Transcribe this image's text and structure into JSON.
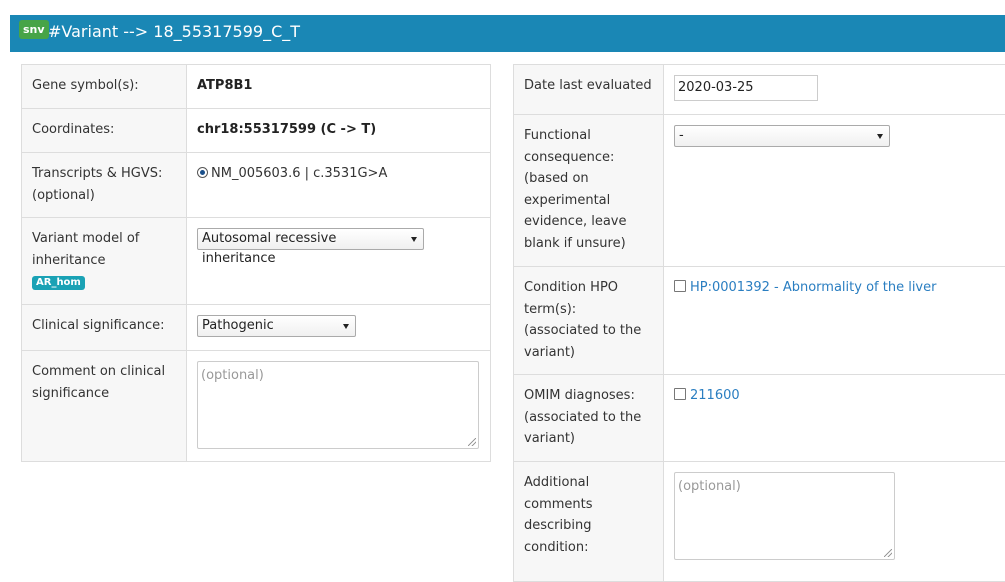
{
  "header": {
    "badge": "snv",
    "title": "#Variant --> 18_55317599_C_T"
  },
  "left": {
    "gene_label": "Gene symbol(s):",
    "gene_value": "ATP8B1",
    "coord_label": "Coordinates:",
    "coord_value": "chr18:55317599 (C -> T)",
    "transcripts_label": "Transcripts & HGVS: (optional)",
    "transcript_option": "NM_005603.6 | c.3531G>A",
    "moi_label": "Variant model of inheritance",
    "moi_tag": "AR_hom",
    "moi_value": "Autosomal recessive inheritance",
    "clinsig_label": "Clinical significance:",
    "clinsig_value": "Pathogenic",
    "comment_label": "Comment on clinical significance",
    "comment_placeholder": "(optional)"
  },
  "right": {
    "date_label": "Date last evaluated",
    "date_value": "2020-03-25",
    "func_label": "Functional consequence: (based on experimental evidence, leave blank if unsure)",
    "func_value": "-",
    "hpo_label": "Condition HPO term(s): (associated to the variant)",
    "hpo_option": "HP:0001392 - Abnormality of the liver",
    "omim_label": "OMIM diagnoses: (associated to the variant)",
    "omim_option": "211600",
    "additional_label": "Additional comments describing condition:",
    "additional_placeholder": "(optional)"
  },
  "colors": {
    "header_bg": "#1a87b5",
    "badge_bg": "#47a447",
    "tag_bg": "#1aa2b5",
    "link": "#2a7ec1"
  }
}
